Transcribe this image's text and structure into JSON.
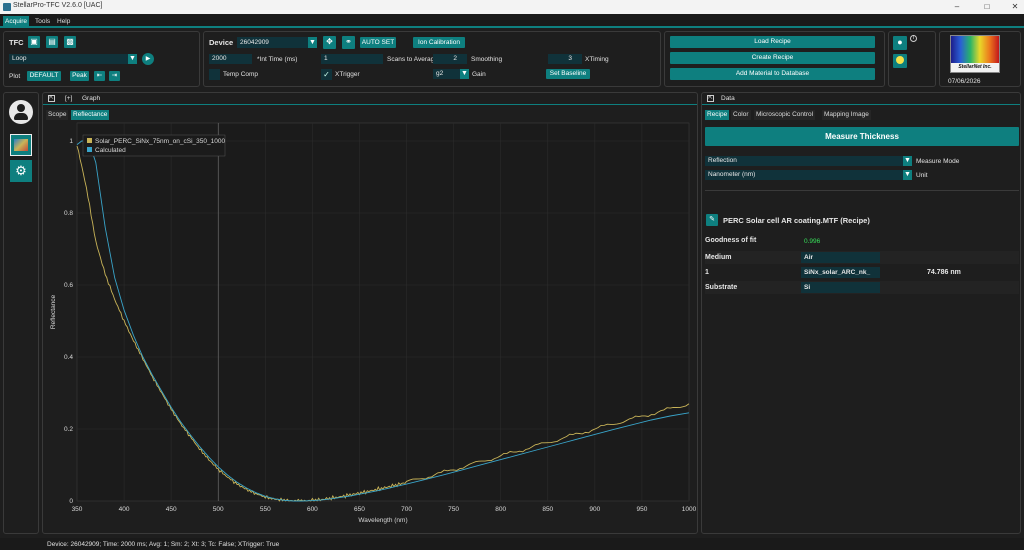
{
  "window": {
    "title": "StellarPro-TFC V2.6.0 [UAC]"
  },
  "menu": [
    "Acquire",
    "Tools",
    "Help"
  ],
  "tfc": {
    "label": "TFC",
    "mode_value": "Loop",
    "plot_label": "Plot",
    "plot_value": "DEFAULT",
    "peak_label": "Peak"
  },
  "device": {
    "label": "Device",
    "value": "26042909",
    "auto_set": "AUTO SET",
    "lamp_calibration": "Ion Calibration",
    "int_time_value": "2000",
    "int_time_label": "*Int Time (ms)",
    "scans_value": "1",
    "scans_label": "Scans to Average",
    "smoothing_value": "2",
    "smoothing_label": "Smoothing",
    "xtiming_value": "3",
    "xtiming_label": "XTiming",
    "temp_comp_label": "Temp Comp",
    "xtrigger_label": "XTrigger",
    "gain_value": "g2",
    "gain_label": "Gain",
    "set_baseline": "Set Baseline"
  },
  "recipe_buttons": {
    "load": "Load Recipe",
    "create": "Create Recipe",
    "add_material": "Add Material to Database"
  },
  "logo": {
    "text": "StellarNet Inc.",
    "date": "07/06/2026"
  },
  "graph": {
    "header": "Graph",
    "expand": "[+]",
    "tabs": [
      "Scope",
      "Reflectance"
    ],
    "active_tab": "Reflectance"
  },
  "chart_data": {
    "type": "line",
    "xlabel": "Wavelength (nm)",
    "ylabel": "Reflectance",
    "xlim": [
      350,
      1000
    ],
    "ylim": [
      0,
      1.05
    ],
    "xticks": [
      350,
      400,
      450,
      500,
      550,
      600,
      650,
      700,
      750,
      800,
      850,
      900,
      950,
      1000
    ],
    "yticks": [
      0,
      0.2,
      0.4,
      0.6,
      0.8,
      1
    ],
    "ytick_labels": [
      "0",
      "0.2",
      "0.4",
      "0.6",
      "0.8",
      "1"
    ],
    "cursor_x": 500,
    "grid": true,
    "legend_position": "top-left",
    "series": [
      {
        "name": "Solar_PERC_SiNx_75nm_on_cSi_350_1000",
        "color": "#c9b458",
        "x": [
          350,
          360,
          370,
          380,
          390,
          400,
          410,
          420,
          430,
          440,
          450,
          460,
          470,
          480,
          490,
          500,
          510,
          520,
          530,
          540,
          550,
          560,
          570,
          580,
          590,
          600,
          610,
          620,
          630,
          640,
          650,
          660,
          670,
          680,
          690,
          700,
          720,
          740,
          760,
          780,
          800,
          820,
          840,
          860,
          880,
          900,
          920,
          940,
          960,
          980,
          1000
        ],
        "y": [
          0.99,
          0.87,
          0.72,
          0.63,
          0.56,
          0.5,
          0.445,
          0.395,
          0.345,
          0.3,
          0.255,
          0.215,
          0.18,
          0.145,
          0.115,
          0.088,
          0.066,
          0.047,
          0.032,
          0.02,
          0.011,
          0.005,
          0.002,
          0.0,
          0.0,
          0.002,
          0.004,
          0.008,
          0.012,
          0.017,
          0.022,
          0.027,
          0.033,
          0.039,
          0.045,
          0.052,
          0.066,
          0.08,
          0.095,
          0.11,
          0.125,
          0.14,
          0.155,
          0.17,
          0.185,
          0.2,
          0.215,
          0.228,
          0.242,
          0.256,
          0.27
        ]
      },
      {
        "name": "Calculated",
        "color": "#39a4c9",
        "x": [
          350,
          355,
          360,
          365,
          370,
          380,
          390,
          400,
          410,
          420,
          430,
          440,
          450,
          460,
          470,
          480,
          490,
          500,
          510,
          520,
          530,
          540,
          550,
          560,
          570,
          580,
          590,
          600,
          610,
          620,
          630,
          640,
          650,
          660,
          670,
          680,
          690,
          700,
          720,
          740,
          760,
          780,
          800,
          820,
          840,
          860,
          880,
          900,
          920,
          940,
          960,
          980,
          1000
        ],
        "y": [
          0.99,
          1.0,
          1.0,
          0.98,
          0.94,
          0.76,
          0.62,
          0.53,
          0.46,
          0.4,
          0.35,
          0.305,
          0.26,
          0.22,
          0.185,
          0.152,
          0.122,
          0.095,
          0.072,
          0.052,
          0.036,
          0.023,
          0.013,
          0.006,
          0.002,
          0.0,
          0.0,
          0.001,
          0.003,
          0.006,
          0.01,
          0.014,
          0.019,
          0.024,
          0.029,
          0.035,
          0.041,
          0.047,
          0.06,
          0.073,
          0.087,
          0.101,
          0.115,
          0.129,
          0.143,
          0.157,
          0.171,
          0.185,
          0.199,
          0.212,
          0.225,
          0.236,
          0.245
        ]
      }
    ]
  },
  "data_panel": {
    "header": "Data",
    "tabs": [
      "Recipe",
      "Color",
      "Microscopic Control",
      "Mapping Image"
    ],
    "active_tab": "Recipe",
    "measure_button": "Measure Thickness",
    "measure_mode_value": "Reflection",
    "measure_mode_label": "Measure Mode",
    "unit_value": "Nanometer (nm)",
    "unit_label": "Unit",
    "recipe_name": "PERC Solar cell AR coating.MTF (Recipe)",
    "goodness_label": "Goodness of fit",
    "goodness_value": "0.996",
    "rows": [
      {
        "label": "Medium",
        "material": "Air",
        "thickness": ""
      },
      {
        "label": "1",
        "material": "SiNx_solar_ARC_nk_",
        "thickness": "74.786 nm"
      },
      {
        "label": "Substrate",
        "material": "Si",
        "thickness": ""
      }
    ]
  },
  "status": "Device: 26042909; Time: 2000 ms; Avg: 1; Sm: 2; Xt: 3; Tc: False; XTrigger: True",
  "colors": {
    "accent": "#0e7f7f",
    "background": "#1e1e1e",
    "goodness": "#37e05a"
  }
}
